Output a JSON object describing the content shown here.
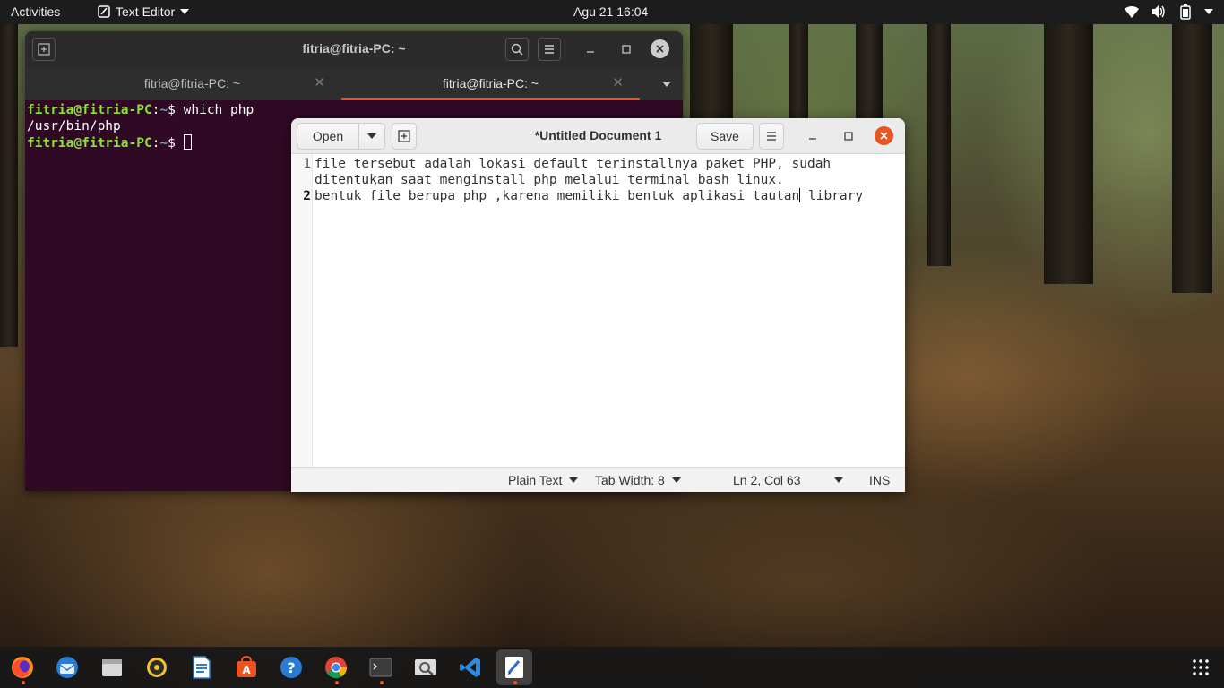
{
  "topbar": {
    "activities": "Activities",
    "app_name": "Text Editor",
    "clock": "Agu 21  16:04"
  },
  "terminal": {
    "window_title": "fitria@fitria-PC: ~",
    "tabs": [
      {
        "label": "fitria@fitria-PC: ~"
      },
      {
        "label": "fitria@fitria-PC: ~"
      }
    ],
    "lines": [
      {
        "user": "fitria@fitria-PC",
        "path": "~",
        "cmd": "which php"
      },
      {
        "output": "/usr/bin/php"
      },
      {
        "user": "fitria@fitria-PC",
        "path": "~",
        "cmd": ""
      }
    ]
  },
  "gedit": {
    "open_label": "Open",
    "save_label": "Save",
    "title": "*Untitled Document 1",
    "lines": [
      {
        "num": "1",
        "text": "file tersebut adalah lokasi default terinstallnya paket PHP, sudah"
      },
      {
        "num": "",
        "text": "ditentukan saat menginstall php melalui terminal bash linux."
      },
      {
        "num": "2",
        "text_before_caret": "bentuk file berupa php ,karena memiliki bentuk aplikasi tautan",
        "text_after_caret": " library"
      }
    ],
    "status": {
      "language": "Plain Text",
      "tab_width": "Tab Width: 8",
      "position": "Ln 2, Col 63",
      "mode": "INS"
    }
  },
  "dock": {
    "apps": [
      "firefox-icon",
      "thunderbird-icon",
      "files-icon",
      "rhythmbox-icon",
      "libreoffice-writer-icon",
      "software-icon",
      "help-icon",
      "chrome-icon",
      "terminal-icon",
      "image-viewer-icon",
      "vscode-icon",
      "text-editor-icon"
    ],
    "accent": "#e95420"
  }
}
